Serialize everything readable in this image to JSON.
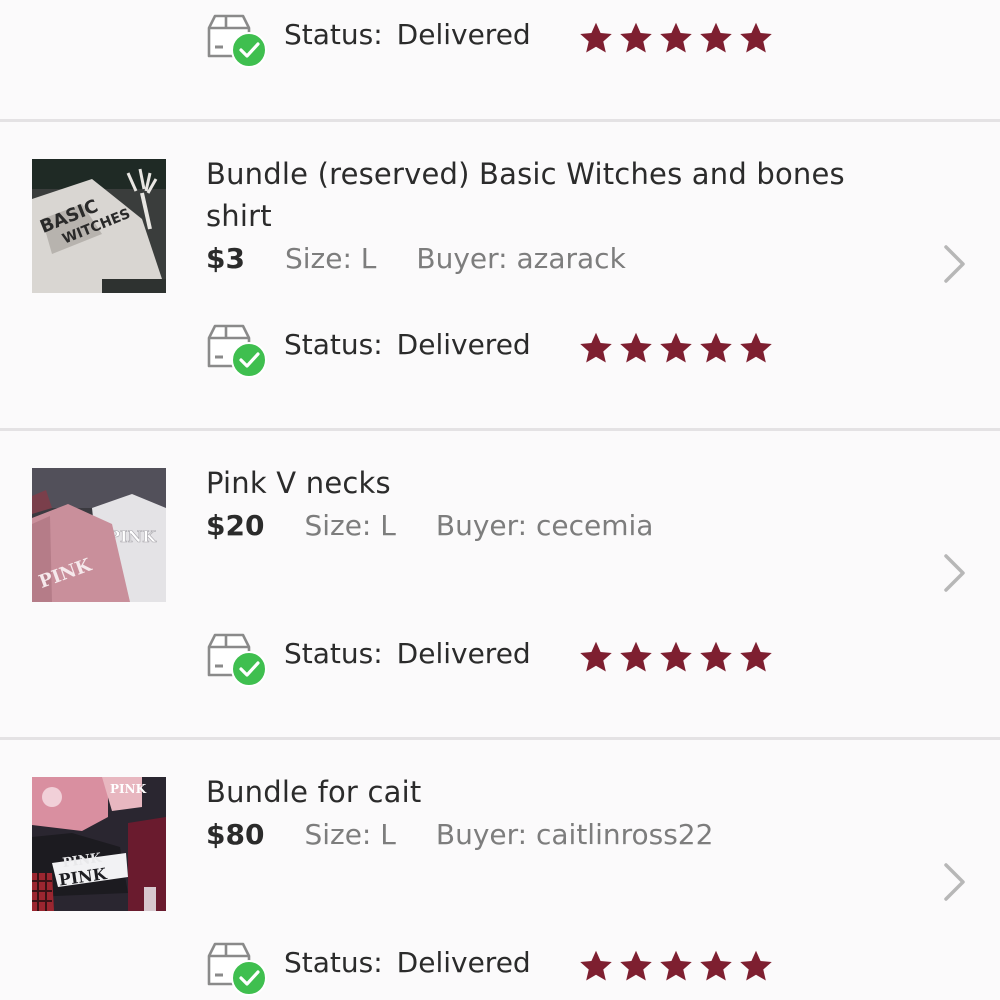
{
  "theme": {
    "star_color": "#7e1f30",
    "delivered_green": "#3fbf4f",
    "divider": "#e4e2e4",
    "text_primary": "#2b2b2b",
    "text_secondary": "#7d7d7d"
  },
  "top_partial": {
    "status_label": "Status:",
    "status_value": "Delivered",
    "rating": 5
  },
  "orders": [
    {
      "title": "Bundle (reserved) Basic Witches and bones shirt",
      "price": "$3",
      "size": "Size: L",
      "buyer": "Buyer: azarack",
      "status_label": "Status:",
      "status_value": "Delivered",
      "rating": 5,
      "thumb_icon": "shirt-photo"
    },
    {
      "title": "Pink V necks",
      "price": "$20",
      "size": "Size: L",
      "buyer": "Buyer: cecemia",
      "status_label": "Status:",
      "status_value": "Delivered",
      "rating": 5,
      "thumb_icon": "shirt-photo"
    },
    {
      "title": "Bundle for cait",
      "price": "$80",
      "size": "Size: L",
      "buyer": "Buyer: caitlinross22",
      "status_label": "Status:",
      "status_value": "Delivered",
      "rating": 5,
      "thumb_icon": "shirt-photo"
    }
  ]
}
